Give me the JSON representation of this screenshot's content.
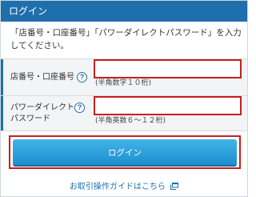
{
  "header": {
    "title": "ログイン"
  },
  "instructions": "「店番号・口座番号」「パワーダイレクトパスワード」を入力してください。",
  "fields": [
    {
      "label": "店番号・口座番号",
      "value": "",
      "hint": "(半角数字１０桁)"
    },
    {
      "label": "パワーダイレクト\nパスワード",
      "value": "",
      "hint": "(半角英数６～１２桁)"
    }
  ],
  "login_button": "ログイン",
  "guide_link": "お取引操作ガイドはこちら",
  "icons": {
    "help": "question-circle-icon",
    "guide": "external-window-icon"
  },
  "colors": {
    "header": "#1f6fad",
    "button": "#2aa0dc",
    "highlight": "#c81e1e"
  }
}
